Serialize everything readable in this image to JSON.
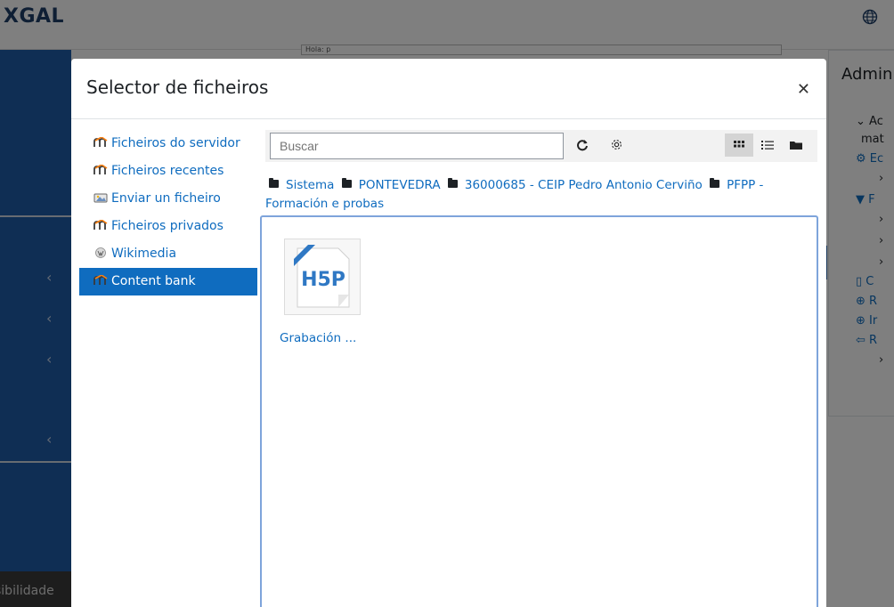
{
  "background": {
    "logo": "XGAL",
    "globe_icon": "globe-icon",
    "textarea_snippet": "Hola: p",
    "accessibility_label": "sibilidade",
    "right_panel": {
      "title": "Admini",
      "lines": [
        "Ac",
        "mat",
        "Ec",
        "F",
        "C",
        "R",
        "Ir",
        "R"
      ]
    }
  },
  "modal": {
    "title": "Selector de ficheiros",
    "close_icon": "close-icon",
    "sidebar": [
      {
        "label": "Ficheiros do servidor",
        "icon": "moodle-icon",
        "active": false
      },
      {
        "label": "Ficheiros recentes",
        "icon": "moodle-icon",
        "active": false
      },
      {
        "label": "Enviar un ficheiro",
        "icon": "upload-icon",
        "active": false
      },
      {
        "label": "Ficheiros privados",
        "icon": "moodle-icon",
        "active": false
      },
      {
        "label": "Wikimedia",
        "icon": "wikimedia-icon",
        "active": false
      },
      {
        "label": "Content bank",
        "icon": "moodle-icon",
        "active": true
      }
    ],
    "search": {
      "placeholder": "Buscar",
      "value": ""
    },
    "breadcrumb": [
      "Sistema",
      "PONTEVEDRA",
      "36000685 - CEIP Pedro Antonio Cerviño",
      "PFPP - Formación e probas"
    ],
    "files": [
      {
        "name": "Grabación ...",
        "icon": "h5p-file-icon"
      }
    ],
    "view_modes": [
      "grid-view-icon",
      "list-view-icon",
      "folder-view-icon"
    ],
    "active_view": "grid-view-icon",
    "colors": {
      "accent": "#0f6cbf",
      "sidebar_bg": "#1f5ca8",
      "file_area_border": "#7ea4db"
    }
  }
}
